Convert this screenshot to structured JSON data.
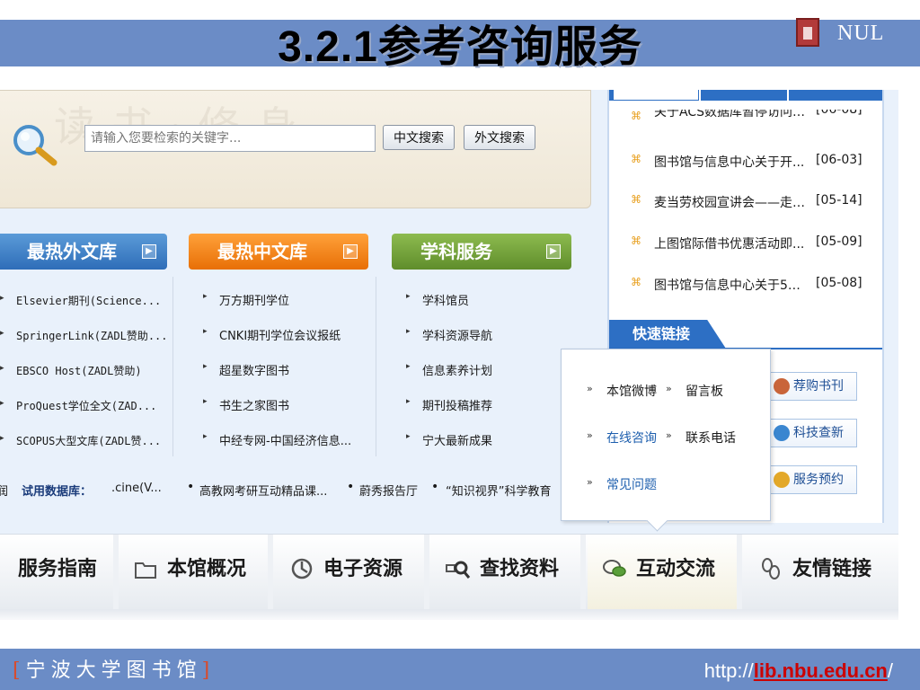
{
  "slide": {
    "title": "3.2.1参考咨询服务",
    "logo_text": "NUL"
  },
  "search": {
    "placeholder": "请输入您要检索的关键字...",
    "watermark": "读书·修身",
    "btn_chinese": "中文搜索",
    "btn_foreign": "外文搜索"
  },
  "news": {
    "items": [
      {
        "title": "关于ACS数据库暂停访问的...",
        "date": "[06-08]"
      },
      {
        "title": "图书馆与信息中心关于开...",
        "date": "[06-03]"
      },
      {
        "title": "麦当劳校园宣讲会——走进...",
        "date": "[05-14]"
      },
      {
        "title": "上图馆际借书优惠活动即...",
        "date": "[05-09]"
      },
      {
        "title": "图书馆与信息中心关于5月...",
        "date": "[05-08]"
      }
    ],
    "bullet": "⌘"
  },
  "quick_links": {
    "heading": "快速链接",
    "buttons": [
      "荐购书刊",
      "科技查新",
      "服务预约"
    ]
  },
  "categories": {
    "foreign": {
      "heading": "最热外文库",
      "items": [
        "Elsevier期刊(Science...",
        "SpringerLink(ZADL赞助...",
        "EBSCO Host(ZADL赞助)",
        "ProQuest学位全文(ZAD...",
        "SCOPUS大型文库(ZADL赞..."
      ]
    },
    "chinese": {
      "heading": "最热中文库",
      "items": [
        "万方期刊学位",
        "CNKI期刊学位会议报纸",
        "超星数字图书",
        "书生之家图书",
        "中经专网-中国经济信息..."
      ]
    },
    "subject": {
      "heading": "学科服务",
      "items": [
        "学科馆员",
        "学科资源导航",
        "信息素养计划",
        "期刊投稿推荐",
        "宁大最新成果"
      ]
    }
  },
  "trial": {
    "prefix": "润",
    "label": "试用数据库：",
    "items": [
      ".cine(V...",
      "高教网考研互动精品课...",
      "蔚秀报告厅",
      "“知识视界”科学教育"
    ]
  },
  "popup": {
    "items": [
      "本馆微博",
      "留言板",
      "在线咨询",
      "联系电话",
      "常见问题"
    ]
  },
  "nav": {
    "items": [
      "服务指南",
      "本馆概况",
      "电子资源",
      "查找资料",
      "互动交流",
      "友情链接"
    ]
  },
  "footer": {
    "library_name": "宁波大学图书馆",
    "url_prefix": "http://",
    "url_domain": "lib.nbu.edu.cn",
    "url_suffix": "/"
  },
  "colors": {
    "band_blue": "#6b8cc6",
    "accent_blue": "#2d6fc4",
    "orange": "#e86f06",
    "green": "#5f8d2b",
    "footer_red": "#cc0000"
  }
}
